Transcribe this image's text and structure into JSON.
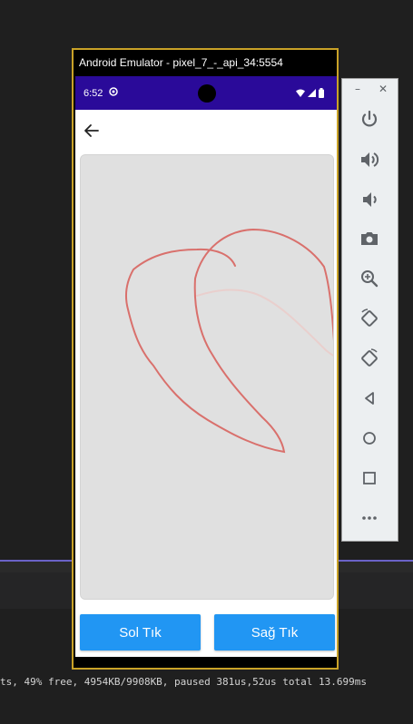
{
  "emulator": {
    "title": "Android Emulator - pixel_7_-_api_34:5554"
  },
  "status_bar": {
    "time": "6:52"
  },
  "buttons": {
    "left_click_label": "Sol Tık",
    "right_click_label": "Sağ Tık"
  },
  "toolbar": {
    "minimize_label": "–",
    "close_label": "✕",
    "items": [
      "power-icon",
      "volume-up-icon",
      "volume-down-icon",
      "camera-icon",
      "zoom-icon",
      "rotate-left-icon",
      "rotate-right-icon",
      "back-icon",
      "home-icon",
      "overview-icon",
      "more-icon"
    ]
  },
  "console": {
    "log_line": "ts, 49% free, 4954KB/9908KB, paused 381us,52us total 13.699ms"
  },
  "colors": {
    "status_bar": "#2a0a99",
    "button": "#2196f3",
    "emulator_border": "#c9a227",
    "stroke_primary": "#d9706c",
    "stroke_faded": "#e9b9b6"
  }
}
